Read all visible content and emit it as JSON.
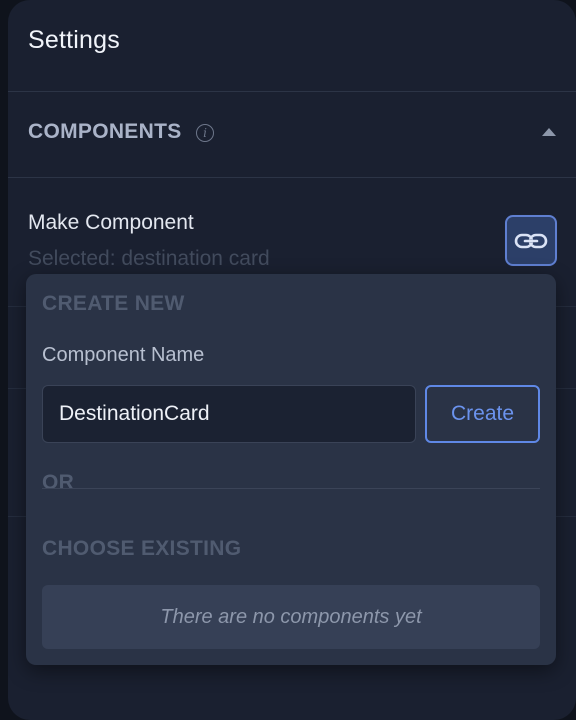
{
  "panel": {
    "title": "Settings"
  },
  "components_section": {
    "title": "COMPONENTS",
    "info_icon": "info-circle-icon",
    "collapse_icon": "caret-up-icon"
  },
  "make_component": {
    "title": "Make Component",
    "selected_text": "Selected: destination card",
    "link_button_icon": "link-icon"
  },
  "popover": {
    "create_new_heading": "CREATE NEW",
    "component_name_label": "Component Name",
    "component_name_value": "DestinationCard",
    "create_button_label": "Create",
    "or_label": "OR",
    "choose_existing_heading": "CHOOSE EXISTING",
    "empty_message": "There are no components yet"
  },
  "colors": {
    "panel_bg": "#1a2030",
    "popover_bg": "#2a3346",
    "accent": "#5f88e6"
  }
}
